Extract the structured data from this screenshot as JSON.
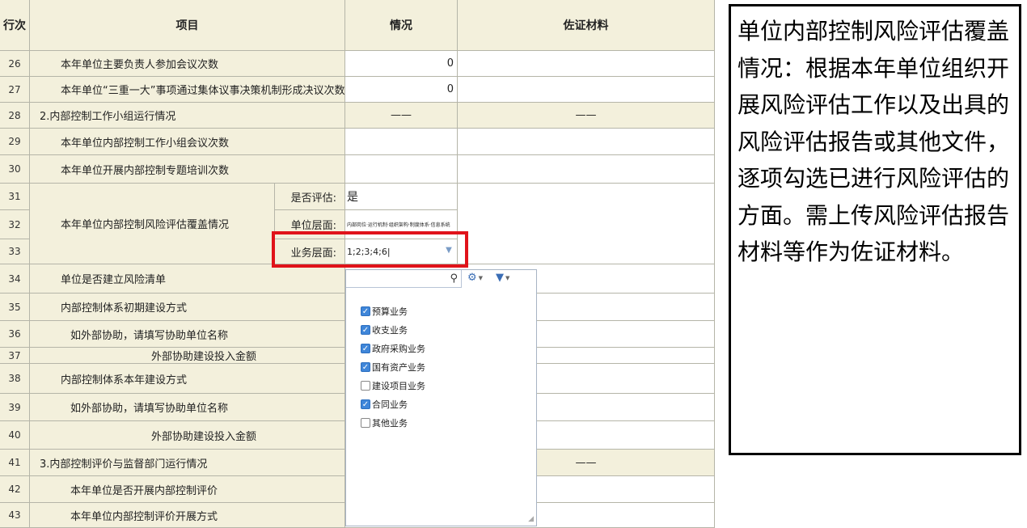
{
  "table": {
    "header": {
      "no": "行次",
      "item": "项目",
      "status": "情况",
      "evidence": "佐证材料"
    },
    "rows": {
      "r26": {
        "no": "26",
        "item": "本年单位主要负责人参加会议次数",
        "status": "0"
      },
      "r27": {
        "no": "27",
        "item": "本年单位“三重一大”事项通过集体议事决策机制形成决议次数",
        "status": "0"
      },
      "r28": {
        "no": "28",
        "item": "2.内部控制工作小组运行情况",
        "status": "——",
        "evidence": "——"
      },
      "r29": {
        "no": "29",
        "item": "本年单位内部控制工作小组会议次数"
      },
      "r30": {
        "no": "30",
        "item": "本年单位开展内部控制专题培训次数"
      },
      "r31": {
        "no": "31",
        "sub_label": "是否评估:",
        "status": "是"
      },
      "r32": {
        "no": "32",
        "sub_label": "单位层面:",
        "status": "内部岗位·运行机制·组织架构·制度体系·信息系统"
      },
      "r33": {
        "no": "33",
        "sub_label": "业务层面:",
        "status": "1;2;3;4;6|"
      },
      "group_31_33": "本年单位内部控制风险评估覆盖情况",
      "r34": {
        "no": "34",
        "item": "单位是否建立风险清单"
      },
      "r35": {
        "no": "35",
        "item": "内部控制体系初期建设方式"
      },
      "r36": {
        "no": "36",
        "item": "如外部协助，请填写协助单位名称"
      },
      "r37": {
        "no": "37",
        "item": "外部协助建设投入金额"
      },
      "r38": {
        "no": "38",
        "item": "内部控制体系本年建设方式"
      },
      "r39": {
        "no": "39",
        "item": "如外部协助，请填写协助单位名称"
      },
      "r40": {
        "no": "40",
        "item": "外部协助建设投入金额"
      },
      "r41": {
        "no": "41",
        "item": "3.内部控制评价与监督部门运行情况",
        "evidence": "——"
      },
      "r42": {
        "no": "42",
        "item": "本年单位是否开展内部控制评价"
      },
      "r43": {
        "no": "43",
        "item": "本年单位内部控制评价开展方式"
      }
    }
  },
  "dropdown": {
    "search_icon": "search-icon",
    "toolbar_icons": [
      "select-all-icon",
      "filter-icon"
    ],
    "options": [
      {
        "label": "预算业务",
        "checked": true
      },
      {
        "label": "收支业务",
        "checked": true
      },
      {
        "label": "政府采购业务",
        "checked": true
      },
      {
        "label": "国有资产业务",
        "checked": true
      },
      {
        "label": "建设项目业务",
        "checked": false
      },
      {
        "label": "合同业务",
        "checked": true
      },
      {
        "label": "其他业务",
        "checked": false
      }
    ]
  },
  "note": {
    "text": "单位内部控制风险评估覆盖情况：根据本年单位组织开展风险评估工作以及出具的风险评估报告或其他文件，逐项勾选已进行风险评估的方面。需上传风险评估报告材料等作为佐证材料。"
  },
  "colors": {
    "highlight_border": "#e0131a",
    "cell_beige": "#f3f0dc",
    "checkbox_blue": "#3f86d9"
  }
}
